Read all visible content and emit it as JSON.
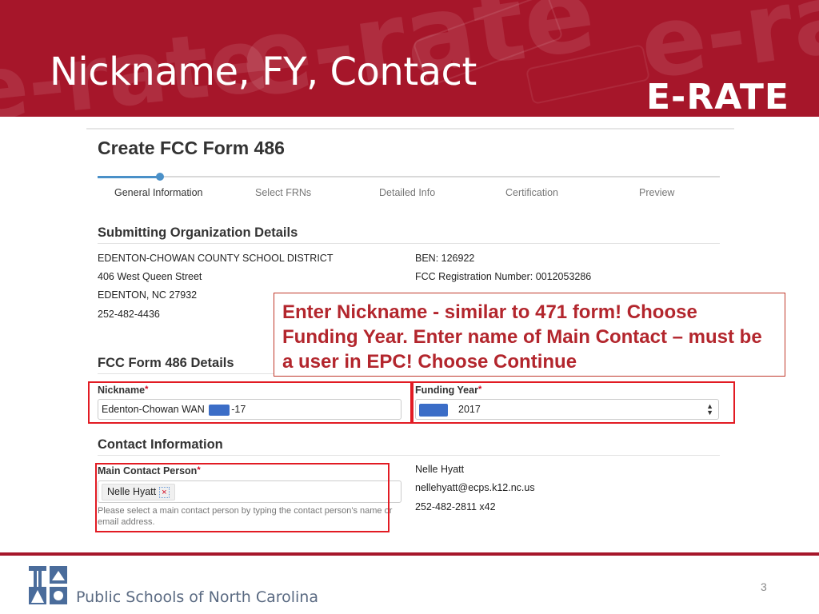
{
  "slide": {
    "title": "Nickname, FY, Contact",
    "brand": "E-RATE",
    "watermark_text": "e-rate",
    "page_number": "3",
    "footer_org": "Public Schools of North Carolina",
    "accent_color": "#a6162a"
  },
  "form": {
    "title": "Create FCC Form 486",
    "steps": [
      {
        "label": "General Information",
        "active": true
      },
      {
        "label": "Select FRNs",
        "active": false
      },
      {
        "label": "Detailed Info",
        "active": false
      },
      {
        "label": "Certification",
        "active": false
      },
      {
        "label": "Preview",
        "active": false
      }
    ],
    "organization": {
      "heading": "Submitting Organization Details",
      "name": "EDENTON-CHOWAN COUNTY SCHOOL DISTRICT",
      "street": "406 West Queen Street",
      "city": "EDENTON, NC 27932",
      "phone": "252-482-4436",
      "ben": "BEN: 126922",
      "fcc_reg": "FCC Registration Number: 0012053286"
    },
    "details": {
      "heading": "FCC Form 486 Details",
      "nickname_label": "Nickname",
      "nickname_value_prefix": "Edenton-Chowan WAN",
      "nickname_value_suffix": "-17",
      "funding_year_label": "Funding Year",
      "funding_year_value": "2017",
      "required_mark": "*"
    },
    "contact": {
      "heading": "Contact Information",
      "main_contact_label": "Main Contact Person",
      "main_contact_tag": "Nelle Hyatt",
      "remove_icon": "×",
      "help_text": "Please select a main contact person by typing the contact person's name or email address.",
      "name": "Nelle Hyatt",
      "email": "nellehyatt@ecps.k12.nc.us",
      "phone": "252-482-2811 x42"
    }
  },
  "callout": {
    "text": "Enter Nickname - similar to 471 form! Choose Funding Year.  Enter name of Main Contact – must be a user in EPC!  Choose Continue",
    "color": "#b3262d"
  },
  "highlight_color": "#e21b23"
}
